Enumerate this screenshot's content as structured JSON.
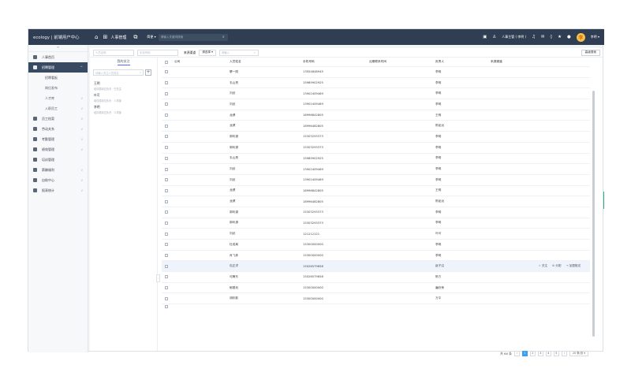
{
  "topbar": {
    "brand": "ecology | 前端用户中心",
    "module": "人事管理",
    "search_scope": "简便 ▾",
    "search_placeholder": "请输入关键词搜索",
    "user_name": "人事主管 ( 李明 )",
    "user_short": "李明 ▾",
    "avatar_initial": "李"
  },
  "sidebar": {
    "collapse_label": "≡",
    "items": [
      {
        "label": "人事首页"
      },
      {
        "label": "招聘管理",
        "active": true
      },
      {
        "label": "员工档案"
      },
      {
        "label": "劳动关系"
      },
      {
        "label": "考勤管理"
      },
      {
        "label": "绩效管理"
      },
      {
        "label": "培训管理"
      },
      {
        "label": "薪酬福利"
      },
      {
        "label": "自助中心"
      },
      {
        "label": "报表统计"
      }
    ],
    "subitems": [
      {
        "label": "招聘看板"
      },
      {
        "label": "岗位发布"
      },
      {
        "label": "人才库"
      },
      {
        "label": "入职员工"
      }
    ]
  },
  "filters": {
    "f1_placeholder": "人员名称",
    "f2_placeholder": "手机号码",
    "label_source": "来源渠道",
    "source_value": "请选择 ▾",
    "search_placeholder": "请输入",
    "advanced_button": "高级搜索"
  },
  "follow": {
    "tab": "我的关注",
    "search_placeholder": "请输入关注人员姓名",
    "contacts": [
      {
        "name": "王明",
        "desc": "培训类岗位负责 · 已关注"
      },
      {
        "name": "叶可",
        "desc": "培训类岗位负责 · 人事部"
      },
      {
        "name": "李明",
        "desc": "培训类岗位负责 · 人事部"
      }
    ]
  },
  "table": {
    "headers": {
      "company": "公司",
      "name": "人员姓名",
      "phone": "手机号码",
      "last_contact": "近期联系时间",
      "owner": "负责人",
      "source": "来源渠道"
    },
    "rows": [
      {
        "name": "攀一刚",
        "phone": "13554848945",
        "owner": "李明"
      },
      {
        "name": "韦山亮",
        "phone": "15989902925",
        "owner": "李明"
      },
      {
        "name": "刘武",
        "phone": "13902409469",
        "owner": "李明"
      },
      {
        "name": "刘武",
        "phone": "13902409469",
        "owner": "李明"
      },
      {
        "name": "龙健",
        "phone": "18996842805",
        "owner": "王明"
      },
      {
        "name": "龙健",
        "phone": "18996482805",
        "owner": "陈如远"
      },
      {
        "name": "郭利源",
        "phone": "15303293373",
        "owner": "李明"
      },
      {
        "name": "郭利源",
        "phone": "15303293373",
        "owner": "李明"
      },
      {
        "name": "韦山亮",
        "phone": "15989902925",
        "owner": "李明"
      },
      {
        "name": "刘武",
        "phone": "13902409469",
        "owner": "李明"
      },
      {
        "name": "刘武",
        "phone": "13902409469",
        "owner": "李明"
      },
      {
        "name": "龙健",
        "phone": "18996842805",
        "owner": "王明"
      },
      {
        "name": "龙健",
        "phone": "18996482805",
        "owner": "陈如远"
      },
      {
        "name": "郭利源",
        "phone": "15303293373",
        "owner": "李明"
      },
      {
        "name": "郭利源",
        "phone": "15303293373",
        "owner": "李明"
      },
      {
        "name": "刘武",
        "phone": "121212121",
        "owner": "叶可"
      },
      {
        "name": "杜成离",
        "phone": "15300000000",
        "owner": "李明"
      },
      {
        "name": "肖飞炼",
        "phone": "15300000000",
        "owner": "李明"
      },
      {
        "name": "包正洋",
        "phone": "15026579658",
        "owner": "赵子沿",
        "highlight": true
      },
      {
        "name": "可腾东",
        "phone": "15026579658",
        "owner": "陈方"
      },
      {
        "name": "郁德划",
        "phone": "15300000000",
        "owner": "廉欣荣"
      },
      {
        "name": "胡彩影",
        "phone": "15300000000",
        "owner": "万平"
      }
    ],
    "row_actions": {
      "follow": "☆ 关注",
      "assign": "⊘ 分配",
      "push": "→ 加盟推送"
    }
  },
  "pager": {
    "total": "共 66 条",
    "prev": "‹",
    "pages": [
      "1",
      "2",
      "3",
      "4",
      "5"
    ],
    "next": "›",
    "size": "20 条/页 ▾"
  }
}
